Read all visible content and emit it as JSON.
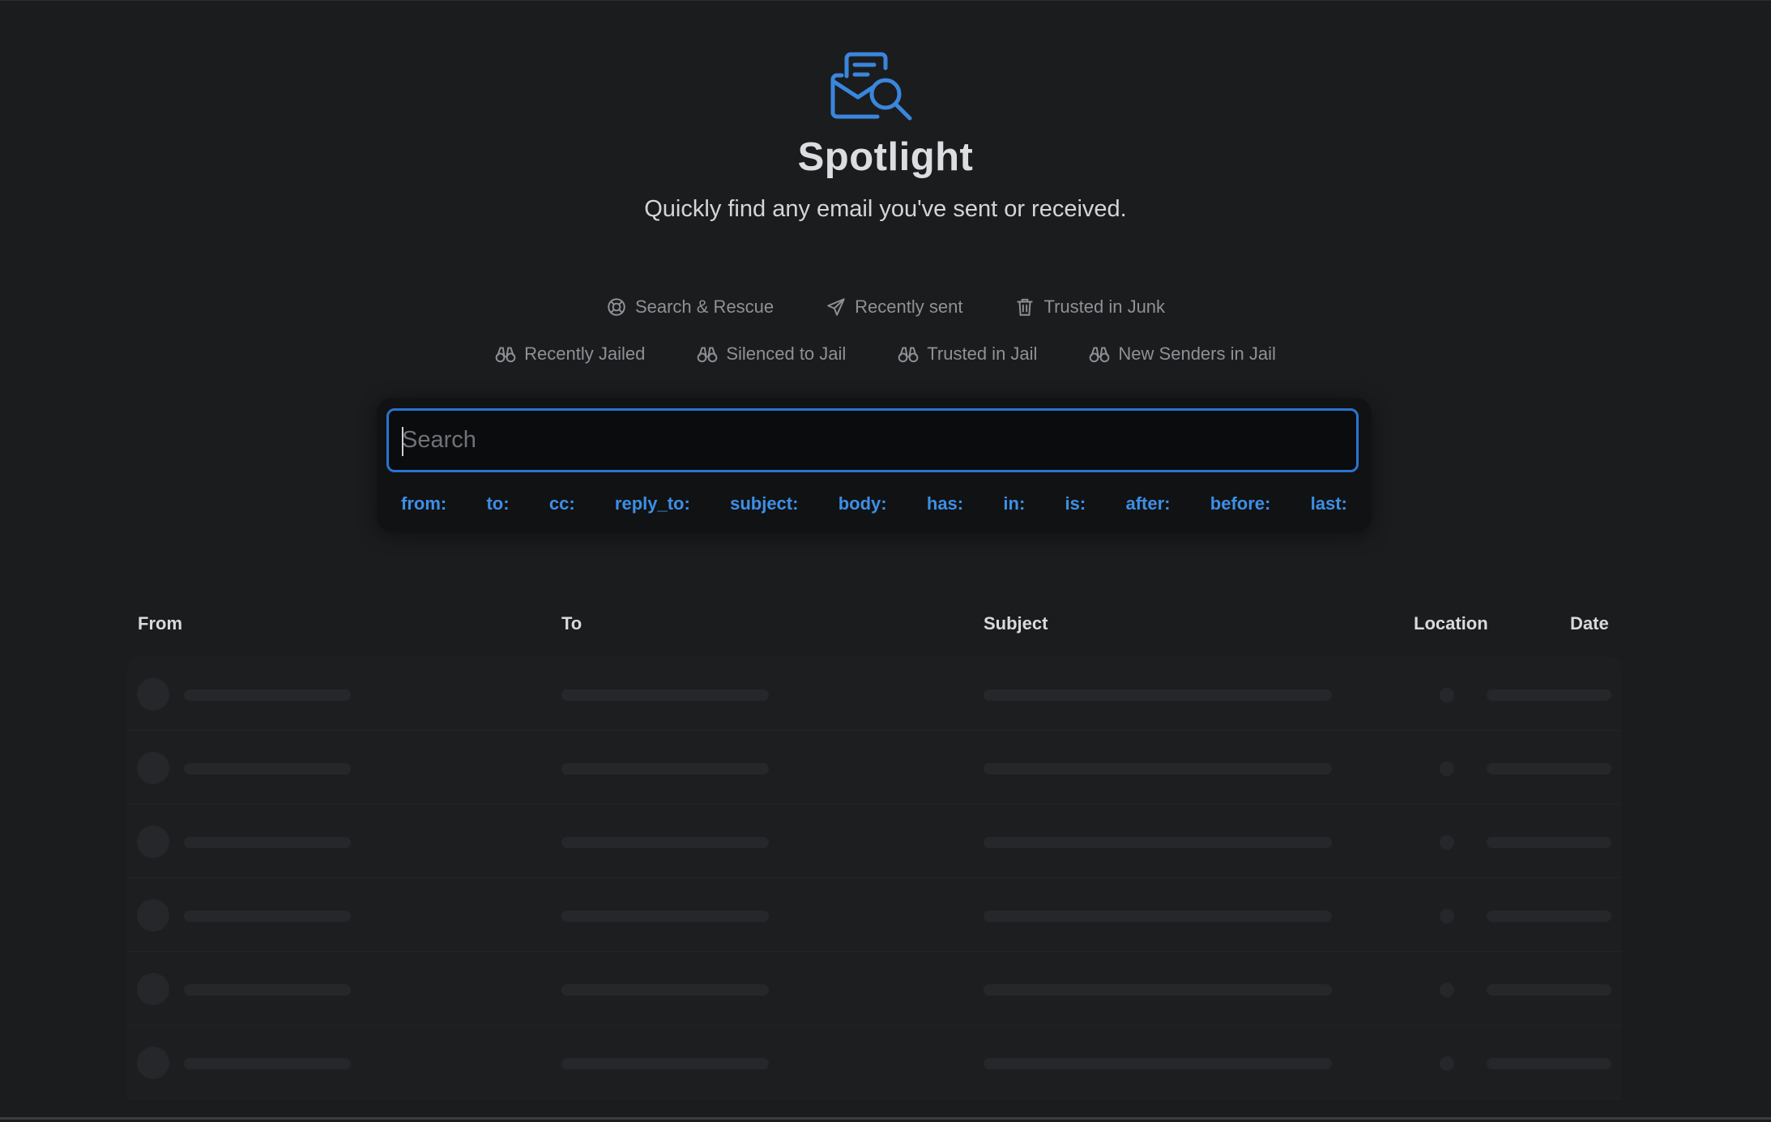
{
  "header": {
    "icon": "envelope-search-icon",
    "title": "Spotlight",
    "subtitle": "Quickly find any email you've sent or received."
  },
  "shortcuts": {
    "row1": [
      {
        "label": "Search & Rescue",
        "icon": "lifebuoy-icon"
      },
      {
        "label": "Recently sent",
        "icon": "paper-plane-icon"
      },
      {
        "label": "Trusted in Junk",
        "icon": "trash-icon"
      }
    ],
    "row2": [
      {
        "label": "Recently Jailed",
        "icon": "binoculars-icon"
      },
      {
        "label": "Silenced to Jail",
        "icon": "binoculars-icon"
      },
      {
        "label": "Trusted in Jail",
        "icon": "binoculars-icon"
      },
      {
        "label": "New Senders in Jail",
        "icon": "binoculars-icon"
      }
    ]
  },
  "search": {
    "placeholder": "Search",
    "value": "",
    "operators": [
      "from:",
      "to:",
      "cc:",
      "reply_to:",
      "subject:",
      "body:",
      "has:",
      "in:",
      "is:",
      "after:",
      "before:",
      "last:"
    ]
  },
  "table": {
    "columns": {
      "from": "From",
      "to": "To",
      "subject": "Subject",
      "location": "Location",
      "date": "Date"
    },
    "loading_rows": 6
  },
  "colors": {
    "background": "#1b1c1e",
    "accent": "#2a73d0",
    "operator_text": "#3d8fe6",
    "muted_text": "#8e9196"
  }
}
